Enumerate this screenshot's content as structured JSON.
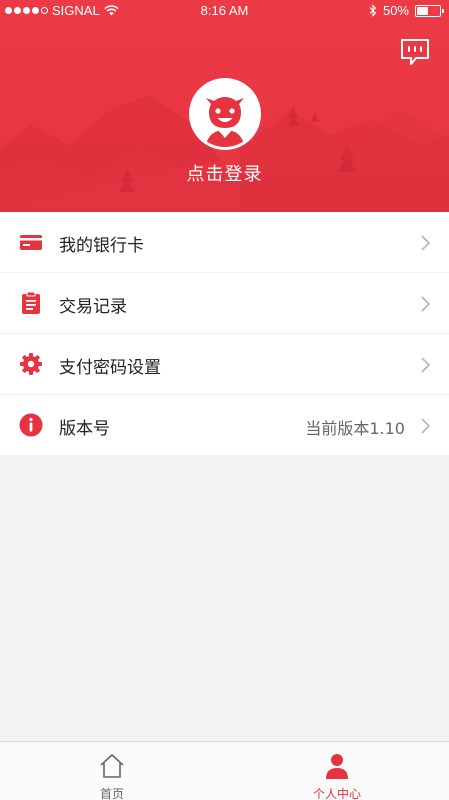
{
  "status_bar": {
    "carrier": "SIGNAL",
    "time": "8:16 AM",
    "battery": "50%",
    "battery_level": 0.5
  },
  "header": {
    "message_icon": "chat-bubble-icon",
    "avatar_icon": "smiley-avatar-icon",
    "login_label": "点击登录"
  },
  "menu": [
    {
      "icon": "bank-card-icon",
      "label": "我的银行卡",
      "value": ""
    },
    {
      "icon": "clipboard-icon",
      "label": "交易记录",
      "value": ""
    },
    {
      "icon": "gear-icon",
      "label": "支付密码设置",
      "value": ""
    },
    {
      "icon": "info-icon",
      "label": "版本号",
      "value": "当前版本1.10"
    }
  ],
  "tabbar": {
    "tabs": [
      {
        "label": "首页",
        "icon": "home-icon",
        "active": false
      },
      {
        "label": "个人中心",
        "icon": "user-icon",
        "active": true
      }
    ]
  },
  "colors": {
    "accent": "#e5333f",
    "background": "#f3f3f5"
  }
}
